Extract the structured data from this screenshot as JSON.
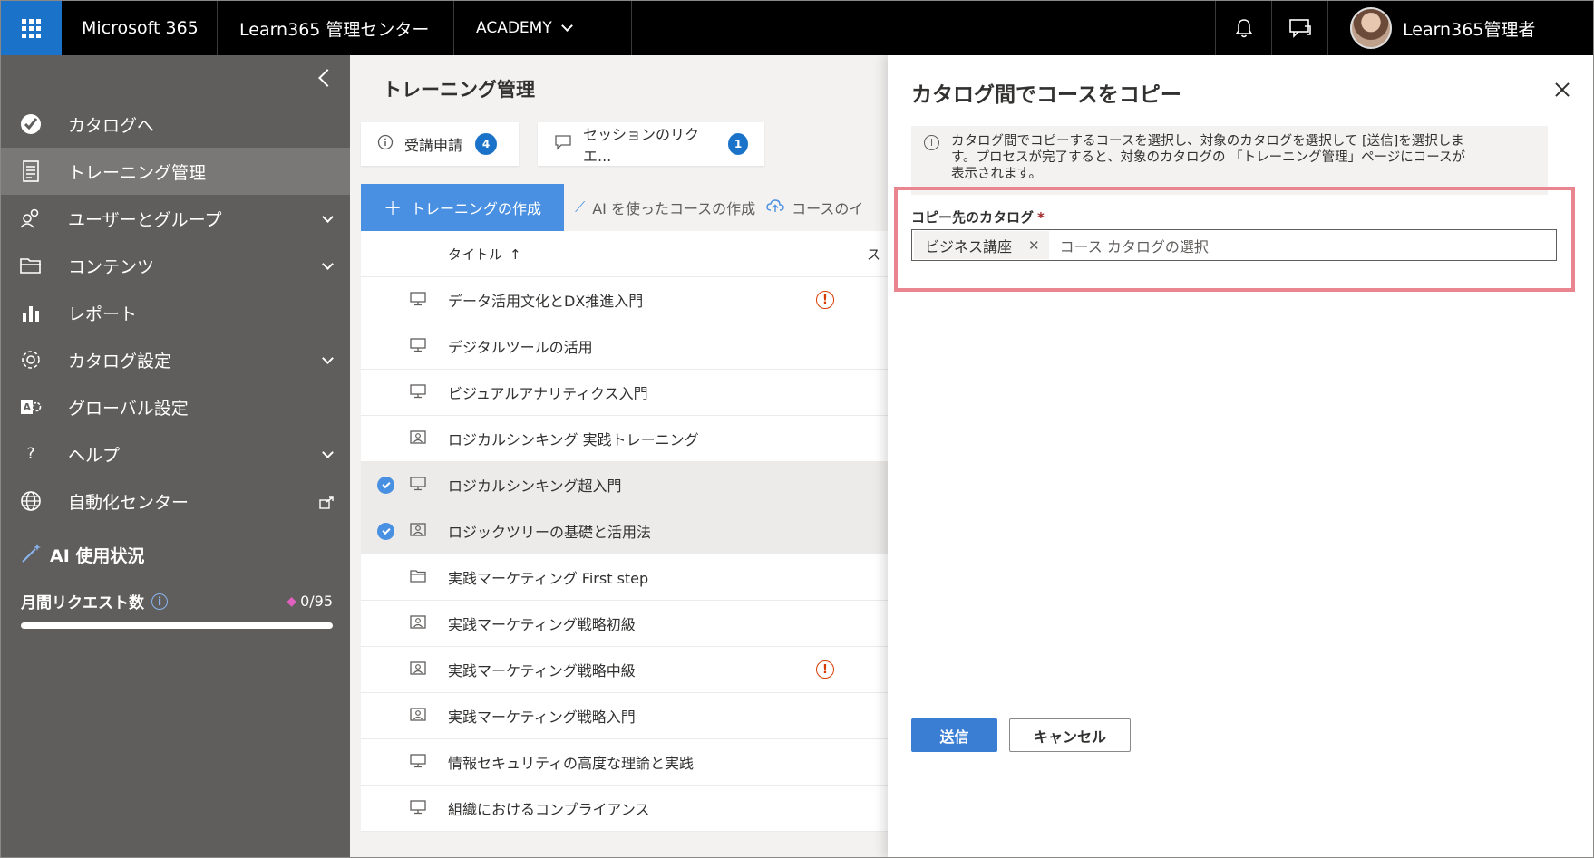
{
  "topbar": {
    "app_name": "Microsoft 365",
    "admin_center": "Learn365 管理センター",
    "tenant": "ACADEMY",
    "user_name": "Learn365管理者"
  },
  "sidebar": {
    "items": [
      {
        "label": "カタログへ",
        "icon": "catalog-icon"
      },
      {
        "label": "トレーニング管理",
        "icon": "document-icon",
        "active": true
      },
      {
        "label": "ユーザーとグループ",
        "icon": "users-icon"
      },
      {
        "label": "コンテンツ",
        "icon": "folder-icon"
      },
      {
        "label": "レポート",
        "icon": "chart-icon"
      },
      {
        "label": "カタログ設定",
        "icon": "gear-icon"
      },
      {
        "label": "グローバル設定",
        "icon": "global-settings-icon"
      },
      {
        "label": "ヘルプ",
        "icon": "help-icon"
      },
      {
        "label": "自動化センター",
        "icon": "globe-icon"
      }
    ],
    "ai_usage_title": "AI 使用状況",
    "monthly_requests_label": "月間リクエスト数",
    "monthly_requests_value": "0/95",
    "monthly_requests_fraction": 0
  },
  "main": {
    "title": "トレーニング管理",
    "cards": [
      {
        "label": "受講申請",
        "count": "4"
      },
      {
        "label": "セッションのリクエ...",
        "count": "1"
      }
    ],
    "toolbar": {
      "create_label": "トレーニングの作成",
      "ai_create_label": "AI を使ったコースの作成",
      "import_label": "コースのイ"
    },
    "table": {
      "col_title": "タイトル",
      "col_s": "ス",
      "rows": [
        {
          "title": "データ活用文化とDX推進入門",
          "type": "monitor",
          "warn": true
        },
        {
          "title": "デジタルツールの活用",
          "type": "monitor"
        },
        {
          "title": "ビジュアルアナリティクス入門",
          "type": "monitor"
        },
        {
          "title": "ロジカルシンキング 実践トレーニング",
          "type": "classroom"
        },
        {
          "title": "ロジカルシンキング超入門",
          "type": "monitor",
          "selected": true
        },
        {
          "title": "ロジックツリーの基礎と活用法",
          "type": "classroom",
          "selected": true
        },
        {
          "title": "実践マーケティング First step",
          "type": "folder"
        },
        {
          "title": "実践マーケティング戦略初級",
          "type": "classroom"
        },
        {
          "title": "実践マーケティング戦略中級",
          "type": "classroom",
          "warn": true
        },
        {
          "title": "実践マーケティング戦略入門",
          "type": "classroom"
        },
        {
          "title": "情報セキュリティの高度な理論と実践",
          "type": "monitor"
        },
        {
          "title": "組織におけるコンプライアンス",
          "type": "monitor"
        }
      ]
    }
  },
  "panel": {
    "title": "カタログ間でコースをコピー",
    "message_line1": "カタログ間でコピーするコースを選択し、対象のカタログを選択して [送信]を選択しま",
    "message_line2": "す。プロセスが完了すると、対象のカタログの 「トレーニング管理」ページにコースが",
    "message_line3": "表示されます。",
    "field_label": "コピー先のカタログ",
    "required_mark": "*",
    "selected_chip": "ビジネス講座",
    "chip_remove": "✕",
    "picker_placeholder": "コース カタログの選択",
    "submit_label": "送信",
    "cancel_label": "キャンセル"
  },
  "colors": {
    "accent": "#1a73c8",
    "sidebar_bg": "#605e5c",
    "highlight_border": "#e8858e",
    "warning": "#d83b01"
  }
}
